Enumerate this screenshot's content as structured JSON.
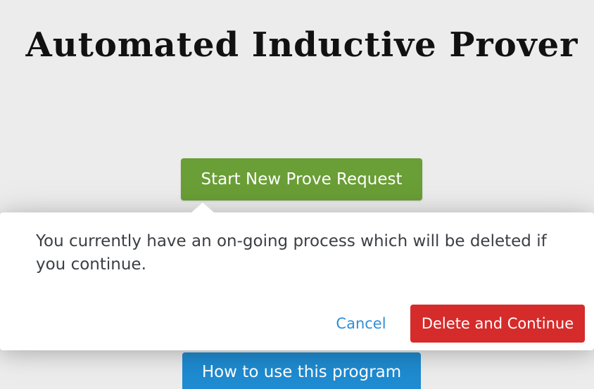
{
  "page": {
    "title": "Automated Inductive Prover"
  },
  "actions": {
    "start_label": "Start New Prove Request",
    "howto_label": "How to use this program"
  },
  "confirm_popover": {
    "message": "You currently have an on-going process which will be deleted if you continue.",
    "cancel_label": "Cancel",
    "delete_label": "Delete and Continue"
  },
  "colors": {
    "background": "#ececec",
    "start_button": "#6a9e36",
    "howto_button": "#1f8bd0",
    "delete_button": "#d62b2b",
    "cancel_link": "#2f8fd6"
  }
}
